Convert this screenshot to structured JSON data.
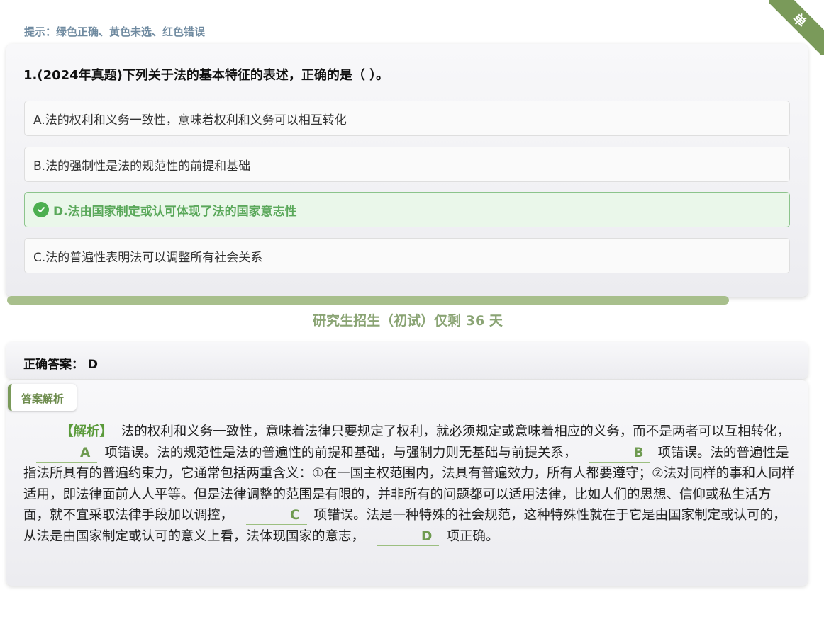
{
  "ribbon": {
    "label": "单"
  },
  "hint": "提示：绿色正确、黄色未选、红色错误",
  "question": {
    "title": "1.(2024年真题)下列关于法的基本特征的表述，正确的是（ ）。",
    "options": [
      {
        "text": "A.法的权利和义务一致性，意味着权利和义务可以相互转化",
        "state": "normal"
      },
      {
        "text": "B.法的强制性是法的规范性的前提和基础",
        "state": "normal"
      },
      {
        "text": "D.法由国家制定或认可体现了法的国家意志性",
        "state": "correct"
      },
      {
        "text": "C.法的普遍性表明法可以调整所有社会关系",
        "state": "normal"
      }
    ]
  },
  "progress": {
    "fraction": 0.88,
    "color": "#a8bf8c"
  },
  "countdown": "研究生招生（初试）仅剩 36 天",
  "answer": {
    "label": "正确答案：",
    "value": "D"
  },
  "explanation": {
    "tag": "答案解析",
    "lead": "【解析】",
    "seg1": "法的权利和义务一致性，意味着法律只要规定了权利，就必须规定或意味着相应的义务，而不是两者可以互相转化，",
    "chipA": "A",
    "seg2": "项错误。法的规范性是法的普遍性的前提和基础，与强制力则无基础与前提关系，",
    "chipB": "B",
    "seg3": "项错误。法的普遍性是指法所具有的普遍约束力，它通常包括两重含义：①在一国主权范围内，法具有普遍效力，所有人都要遵守；②法对同样的事和人同样适用，即法律面前人人平等。但是法律调整的范围是有限的，并非所有的问题都可以适用法律，比如人们的思想、信仰或私生活方面，就不宜采取法律手段加以调控，",
    "chipC": "C",
    "seg4": "项错误。法是一种特殊的社会规范，这种特殊性就在于它是由国家制定或认可的，从法是由国家制定或认可的意义上看，法体现国家的意志，",
    "chipD": "D",
    "seg5": "项正确。"
  },
  "colors": {
    "accent": "#7a9a5a",
    "correct_bg": "#eaf7ea",
    "correct_text": "#5aa85a"
  }
}
